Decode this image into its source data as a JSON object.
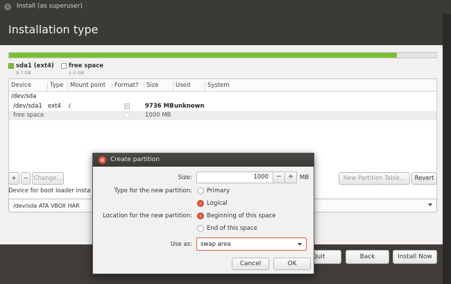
{
  "window": {
    "title": "Install (as superuser)",
    "page_title": "Installation type"
  },
  "disk_usage": {
    "used_fraction": 0.907,
    "colors": {
      "used": "#7bbf35",
      "free": "#e4e4e2"
    },
    "legend": [
      {
        "name": "sda1 (ext4)",
        "size": "9.7 GB",
        "color": "#7bbf35"
      },
      {
        "name": "free space",
        "size": "1.0 GB",
        "color": "#ffffff"
      }
    ]
  },
  "partition_table": {
    "columns": [
      "Device",
      "Type",
      "Mount point",
      "Format?",
      "Size",
      "Used",
      "System"
    ],
    "rows": [
      {
        "device": "/dev/sda",
        "type": "",
        "mount": "",
        "format": "",
        "size": "",
        "used": "",
        "system": ""
      },
      {
        "device": "/dev/sda1",
        "type": "ext4",
        "mount": "/",
        "format": "checked",
        "size": "9736 MB",
        "used": "unknown",
        "system": ""
      },
      {
        "device": "free space",
        "type": "",
        "mount": "",
        "format": "unchecked",
        "size": "1000 MB",
        "used": "",
        "system": ""
      }
    ]
  },
  "table_actions": {
    "add": "+",
    "remove": "−",
    "change": "Change...",
    "new_partition_table": "New Partition Table...",
    "revert": "Revert"
  },
  "boot_loader": {
    "label": "Device for boot loader insta",
    "value": "/dev/sda   ATA VBOX HAR"
  },
  "footer": {
    "quit": "Quit",
    "back": "Back",
    "install_now": "Install Now"
  },
  "dialog": {
    "title": "Create partition",
    "size_label": "Size:",
    "size_value": "1000",
    "size_unit": "MB",
    "minus": "−",
    "plus": "+",
    "type_label": "Type for the new partition:",
    "type_options": [
      "Primary",
      "Logical"
    ],
    "type_selected": "Logical",
    "location_label": "Location for the new partition:",
    "location_options": [
      "Beginning of this space",
      "End of this space"
    ],
    "location_selected": "Beginning of this space",
    "use_as_label": "Use as:",
    "use_as_value": "swap area",
    "cancel": "Cancel",
    "ok": "OK",
    "accent_color": "#e2553a"
  }
}
